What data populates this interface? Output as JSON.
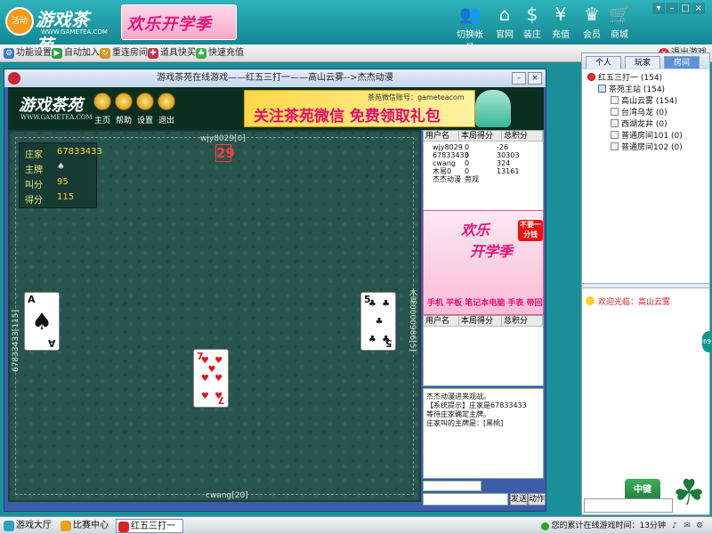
{
  "top": {
    "logo_seal": "活动",
    "brand": "游戏茶苑",
    "url": "WWW.GAMETEA.COM",
    "promo": "欢乐开学季",
    "buttons": [
      {
        "label": "切换帐号",
        "icon": "users-icon"
      },
      {
        "label": "官网",
        "icon": "home-icon"
      },
      {
        "label": "装庄",
        "icon": "dollar-icon"
      },
      {
        "label": "充值",
        "icon": "yen-icon"
      },
      {
        "label": "会员",
        "icon": "vip-crown-icon"
      },
      {
        "label": "商城",
        "icon": "cart-icon"
      }
    ]
  },
  "menubar": {
    "items": [
      {
        "label": "功能设置",
        "icon": "settings-icon",
        "color": "#3a7bd5"
      },
      {
        "label": "自动加入",
        "icon": "auto-join-icon",
        "color": "#2e9e46"
      },
      {
        "label": "重连房间",
        "icon": "reconnect-icon",
        "color": "#d1961a"
      },
      {
        "label": "道具快买",
        "icon": "shop-icon",
        "color": "#c2334d"
      },
      {
        "label": "快速充值",
        "icon": "recharge-icon",
        "color": "#3cb04f"
      }
    ],
    "exit": "退出游戏"
  },
  "game": {
    "title": "游戏茶苑在线游戏——红五三打一——高山云雾-->杰杰动漫",
    "header": {
      "brand": "游戏茶苑",
      "url": "WWW.GAMETEA.COM",
      "nav": [
        "主页",
        "帮助",
        "设置",
        "退出"
      ],
      "ad_small": "茶苑微信账号：gameteacom",
      "ad_big": "关注茶苑微信 免费领取礼包"
    },
    "info": {
      "dealer_label": "庄家",
      "dealer_value": "67833433",
      "trump_label": "主牌",
      "trump_value": "♠",
      "call_label": "叫分",
      "call_value": "95",
      "score_label": "得分",
      "score_value": "115"
    },
    "players": {
      "top": "wjy8029[0]",
      "left": "67833433[115]",
      "right": "木易0000986[5]",
      "bottom": "cwang[20]"
    },
    "counter": "29",
    "cards": {
      "left": {
        "rank": "A",
        "suit": "♠",
        "color": "black"
      },
      "right": {
        "rank": "5",
        "suit": "♣",
        "color": "black"
      },
      "center": {
        "rank": "7",
        "suit": "♥",
        "color": "red"
      }
    },
    "score_table": {
      "headers": [
        "用户名",
        "本局得分",
        "总积分"
      ],
      "rows": [
        [
          "wjy8029",
          "0",
          "-26"
        ],
        [
          "67833433",
          "0",
          "30303"
        ],
        [
          "cwang",
          "0",
          "324"
        ],
        [
          "木易0",
          "0",
          "13161"
        ],
        [
          "杰杰动漫",
          "旁观",
          ""
        ]
      ]
    },
    "side_ad": {
      "line1": "欢乐",
      "line2": "开学季",
      "badge": "不要一分钱",
      "line3": "手机 平板 笔记本电脑 手表 带回家"
    },
    "user_table": {
      "headers": [
        "用户名",
        "本局得分",
        "总积分"
      ]
    },
    "chat": [
      "杰杰动漫进来观战。",
      "【系统提示】庄家是67833433",
      "等待庄家确定主牌。",
      "庄家叫的主牌是：[黑桃]"
    ],
    "buttons": {
      "send": "发送",
      "action": "动作"
    }
  },
  "rpanel": {
    "tabs": [
      "个人",
      "玩家",
      "房间"
    ],
    "tree": [
      {
        "label": "红五三打一 (154)",
        "indent": 0,
        "icon": "heart"
      },
      {
        "label": "茶苑主站 (154)",
        "indent": 1,
        "icon": "server"
      },
      {
        "label": "高山云雾 (154)",
        "indent": 2,
        "icon": "room"
      },
      {
        "label": "台湾乌龙 (0)",
        "indent": 2,
        "icon": "room"
      },
      {
        "label": "西湖龙井 (0)",
        "indent": 2,
        "icon": "room"
      },
      {
        "label": "普通房间101 (0)",
        "indent": 2,
        "icon": "room"
      },
      {
        "label": "普通房间102 (0)",
        "indent": 2,
        "icon": "room"
      }
    ],
    "welcome": "欢迎光临：高山云雾",
    "zhongjian": "中键"
  },
  "sidehandle": "69",
  "taskbar": {
    "items": [
      {
        "label": "游戏大厅",
        "active": false,
        "color": "#2aa0c8"
      },
      {
        "label": "比赛中心",
        "active": false,
        "color": "#e9a316"
      },
      {
        "label": "红五三打一",
        "active": true,
        "color": "#d22"
      }
    ],
    "status": "您的累计在线游戏时间：13分钟"
  }
}
